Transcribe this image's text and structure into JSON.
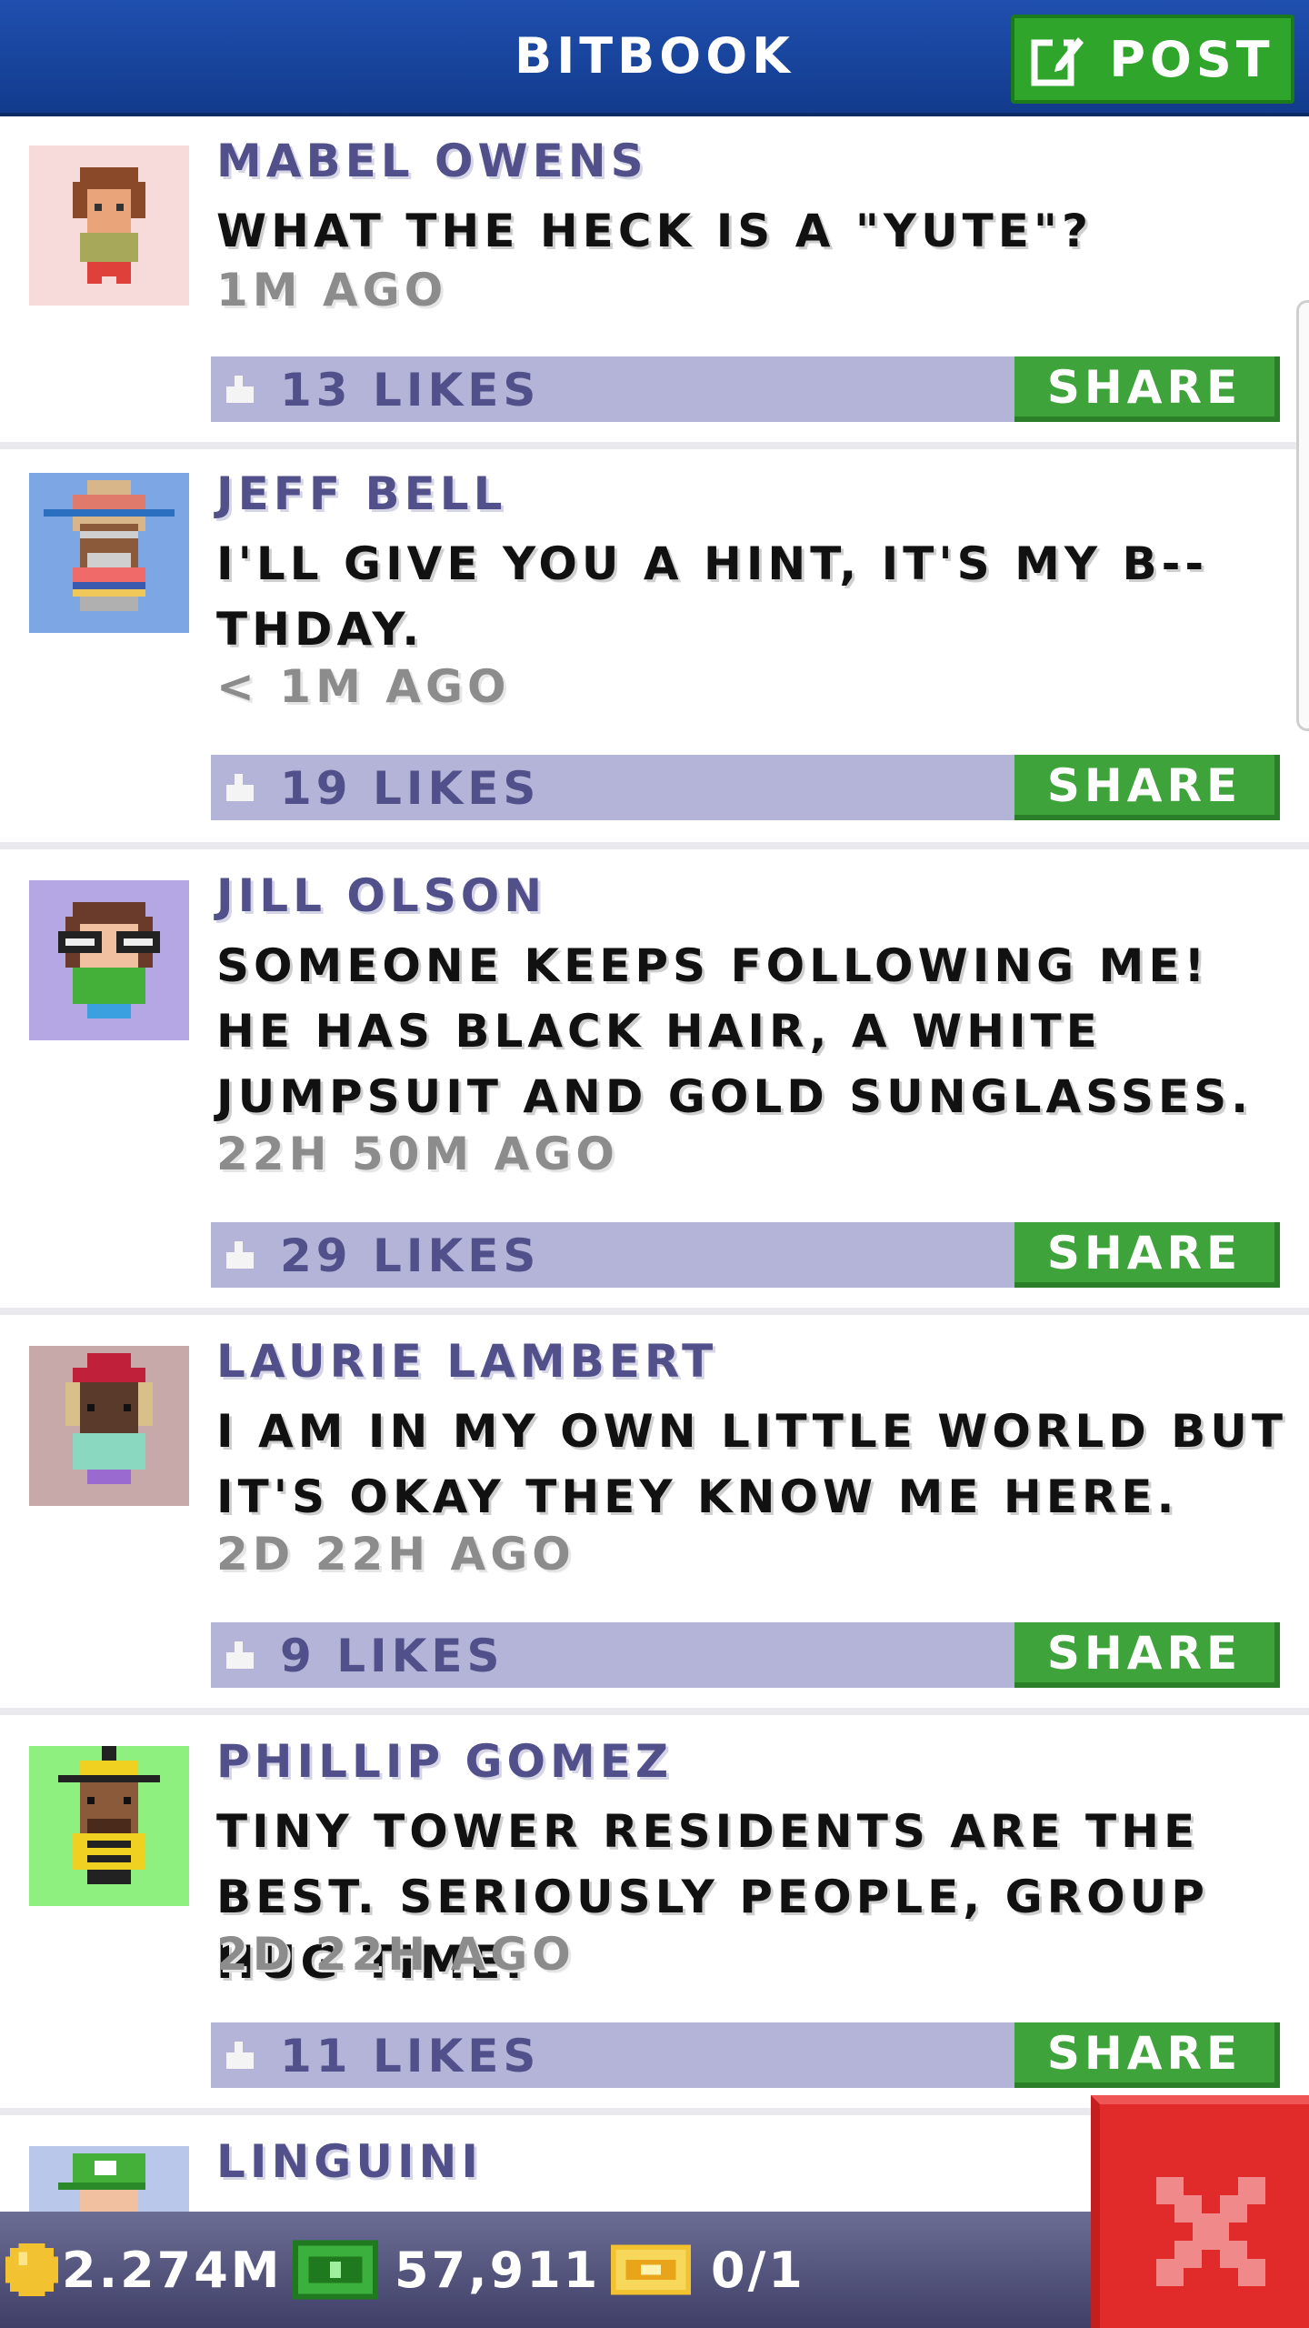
{
  "header": {
    "title": "BITBOOK",
    "post_label": "POST"
  },
  "colors": {
    "header_blue": "#1f4faf",
    "name_purple": "#52508a",
    "likebar": "#b3b4d7",
    "share_green": "#3ea33a",
    "close_red": "#e12a2a"
  },
  "posts": [
    {
      "name": "MABEL OWENS",
      "message": "WHAT THE HECK IS A \"YUTE\"?",
      "time": "1M AGO",
      "likes": "13 LIKES",
      "share": "SHARE",
      "avatar_bg": "#f7dada",
      "icon": "avatar-mabel-icon"
    },
    {
      "name": "JEFF BELL",
      "message": "I'LL GIVE YOU A HINT, IT'S MY B--THDAY.",
      "time": "< 1M AGO",
      "likes": "19 LIKES",
      "share": "SHARE",
      "avatar_bg": "#7da6e4",
      "icon": "avatar-jeff-icon"
    },
    {
      "name": "JILL OLSON",
      "message": "SOMEONE KEEPS FOLLOWING ME! HE HAS BLACK HAIR, A WHITE JUMPSUIT AND GOLD SUNGLASSES.",
      "time": "22H 50M AGO",
      "likes": "29 LIKES",
      "share": "SHARE",
      "avatar_bg": "#b5a6e4",
      "icon": "avatar-jill-icon"
    },
    {
      "name": "LAURIE LAMBERT",
      "message": "I AM IN MY OWN LITTLE WORLD BUT IT'S OKAY THEY KNOW ME HERE.",
      "time": "2D 22H AGO",
      "likes": "9 LIKES",
      "share": "SHARE",
      "avatar_bg": "#c8a9a9",
      "icon": "avatar-laurie-icon"
    },
    {
      "name": "PHILLIP GOMEZ",
      "message": "TINY TOWER RESIDENTS ARE THE BEST. SERIOUSLY PEOPLE, GROUP HUG TIME.",
      "time": "2D 22H AGO",
      "likes": "11 LIKES",
      "share": "SHARE",
      "avatar_bg": "#8ef07f",
      "icon": "avatar-phillip-icon"
    },
    {
      "name": "LINGUINI",
      "message": "",
      "time": "",
      "likes": "",
      "share": "",
      "avatar_bg": "#b8c7ea",
      "icon": "avatar-linguini-icon"
    }
  ],
  "bottombar": {
    "coins": "2.274M",
    "bux": "57,911",
    "tickets": "0/1"
  }
}
